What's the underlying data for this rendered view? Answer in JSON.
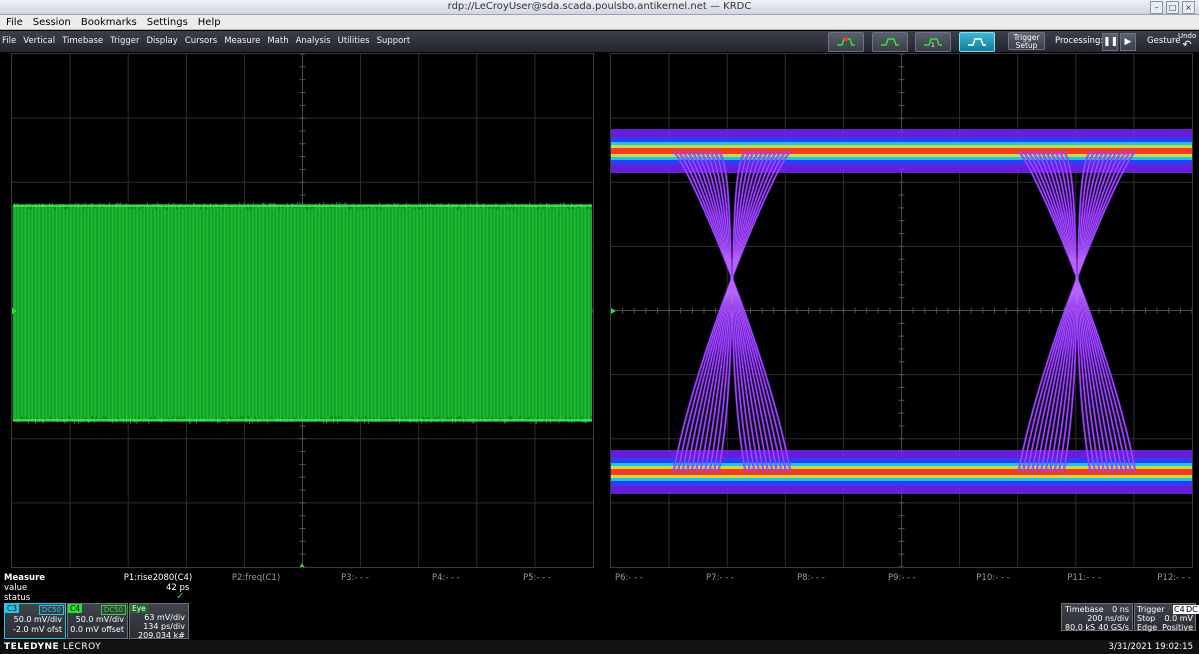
{
  "window": {
    "title": "rdp://LeCroyUser@sda.scada.poulsbo.antikernel.net — KRDC"
  },
  "krdc_menu": [
    "File",
    "Session",
    "Bookmarks",
    "Settings",
    "Help"
  ],
  "scope_menu": [
    "File",
    "Vertical",
    "Timebase",
    "Trigger",
    "Display",
    "Cursors",
    "Measure",
    "Math",
    "Analysis",
    "Utilities",
    "Support"
  ],
  "toolbar": {
    "trigger_setup": [
      "Trigger",
      "Setup"
    ],
    "processing": "Processing:",
    "gesture": "Gesture",
    "undo": "Undo"
  },
  "params": [
    "P1:rise2080(C4)",
    "P2:freq(C1)",
    "P3:- - -",
    "P4:- - -",
    "P5:- - -",
    "P6:- - -",
    "P7:- - -",
    "P8:- - -",
    "P9:- - -",
    "P10:- - -",
    "P11:- - -",
    "P12:- - -"
  ],
  "measure": {
    "title": "Measure",
    "row1": "value",
    "row2": "status",
    "p1_value": "42 ps",
    "status_icon": "check-icon"
  },
  "channels": [
    {
      "tag": "C3",
      "coupling": "DC50",
      "color": "#20c8e8",
      "line1": "50.0 mV/div",
      "line2": "-2.0 mV ofst"
    },
    {
      "tag": "C4",
      "coupling": "DC50",
      "color": "#28e028",
      "line1": "50.0 mV/div",
      "line2": "0.0 mV offset"
    },
    {
      "tag": "Eye",
      "coupling": "",
      "color": "#c8c8c8",
      "line1": "63 mV/div",
      "line2": "134 ps/div",
      "line3": "209.034 k#"
    }
  ],
  "timebase": {
    "label": "Timebase",
    "delay": "0 ns",
    "tdiv": "200 ns/div",
    "samples": "80.0 kS",
    "rate": "40 GS/s"
  },
  "trigger": {
    "label": "Trigger",
    "src": "C4",
    "coupling": "DC",
    "mode": "Stop",
    "level": "0.0 mV",
    "type": "Edge",
    "slope": "Positive"
  },
  "footer": {
    "brand_a": "TELEDYNE",
    "brand_b": "LECROY",
    "datetime": "3/31/2021 19:02:15"
  }
}
